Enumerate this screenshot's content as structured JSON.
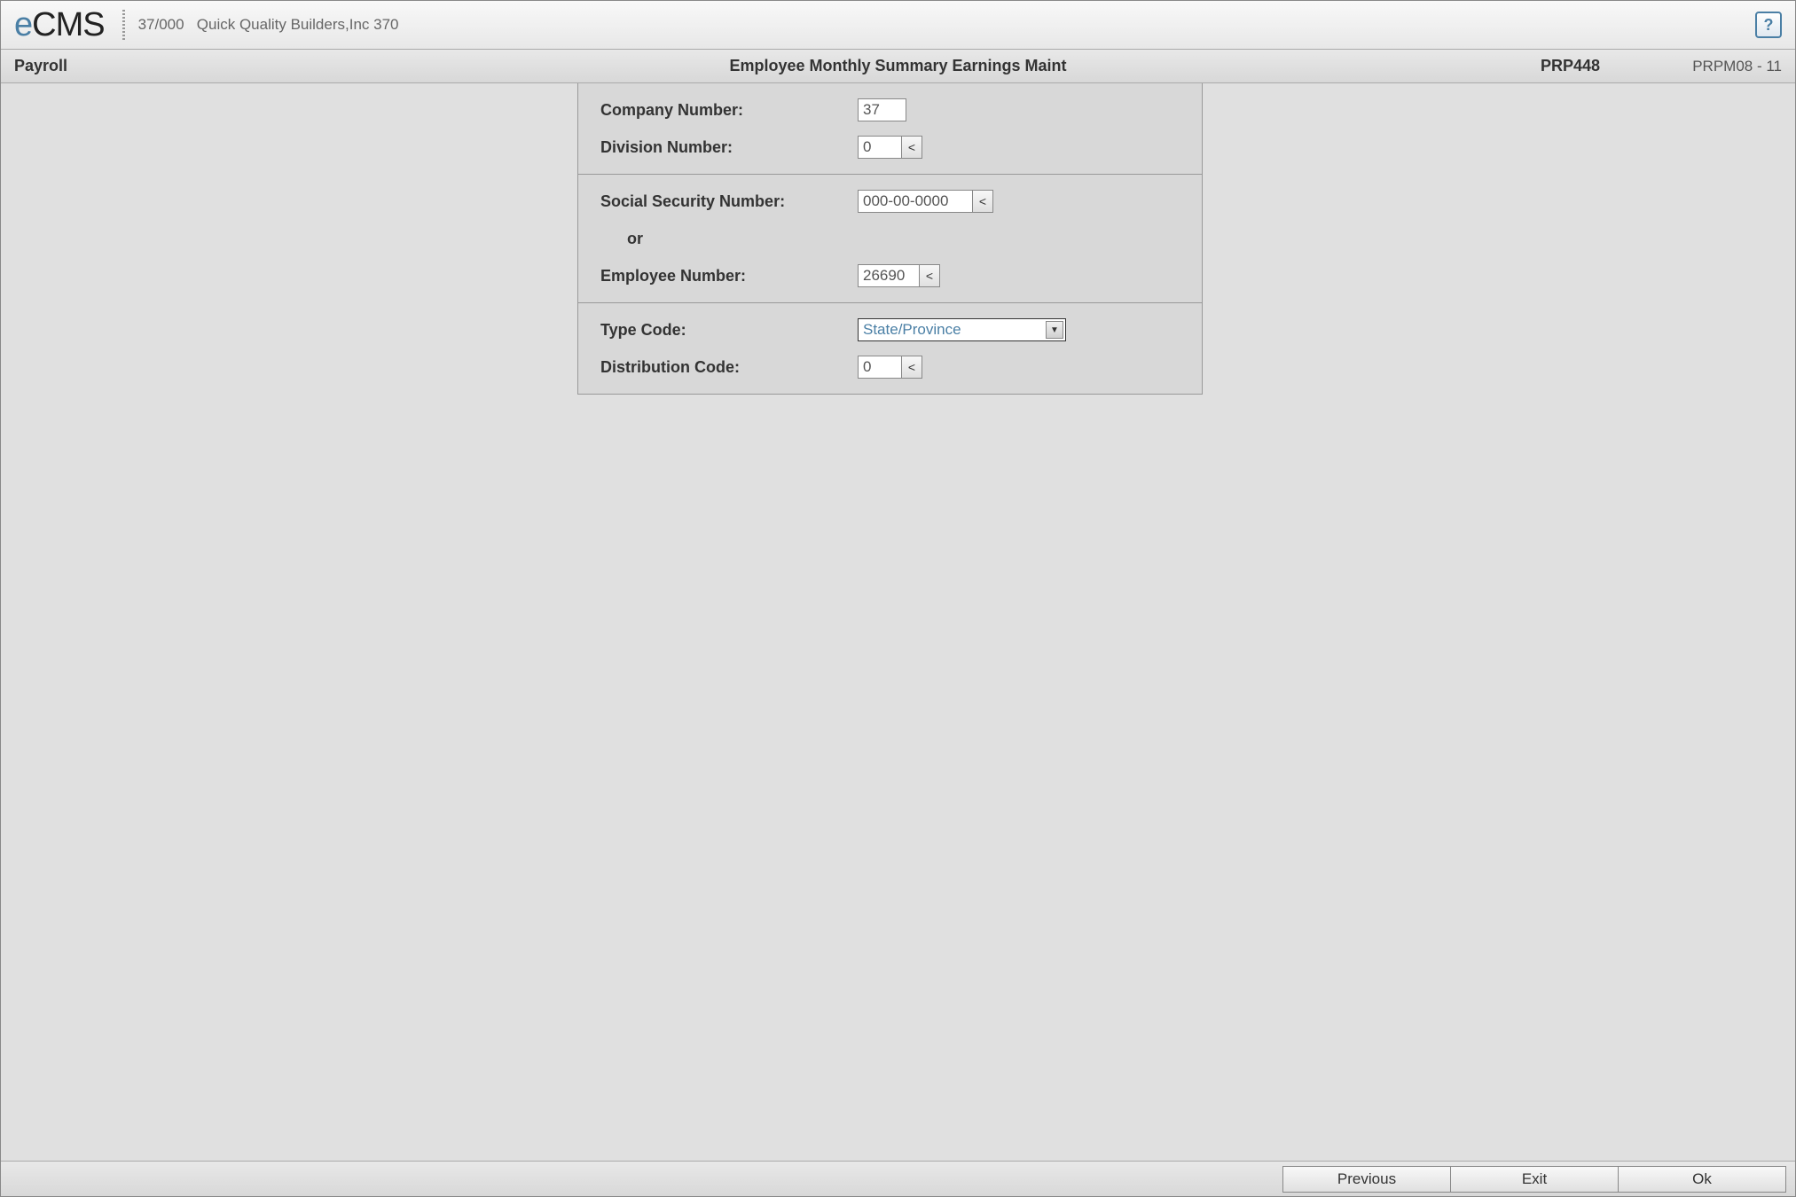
{
  "header": {
    "logo_prefix": "e",
    "logo_text": "CMS",
    "company_id": "37/000",
    "company_name": "Quick Quality Builders,Inc 370",
    "help_label": "?"
  },
  "titlebar": {
    "module": "Payroll",
    "screen_title": "Employee Monthly Summary Earnings Maint",
    "program_code": "PRP448",
    "program_id": "PRPM08 - 11"
  },
  "form": {
    "company_number_label": "Company Number:",
    "company_number_value": "37",
    "division_number_label": "Division Number:",
    "division_number_value": "0",
    "ssn_label": "Social Security Number:",
    "ssn_value": "000-00-0000",
    "or_label": "or",
    "employee_number_label": "Employee Number:",
    "employee_number_value": "26690",
    "type_code_label": "Type Code:",
    "type_code_value": "State/Province",
    "distribution_code_label": "Distribution Code:",
    "distribution_code_value": "0",
    "lookup_label": "<"
  },
  "footer": {
    "previous_label": "Previous",
    "exit_label": "Exit",
    "ok_label": "Ok"
  }
}
